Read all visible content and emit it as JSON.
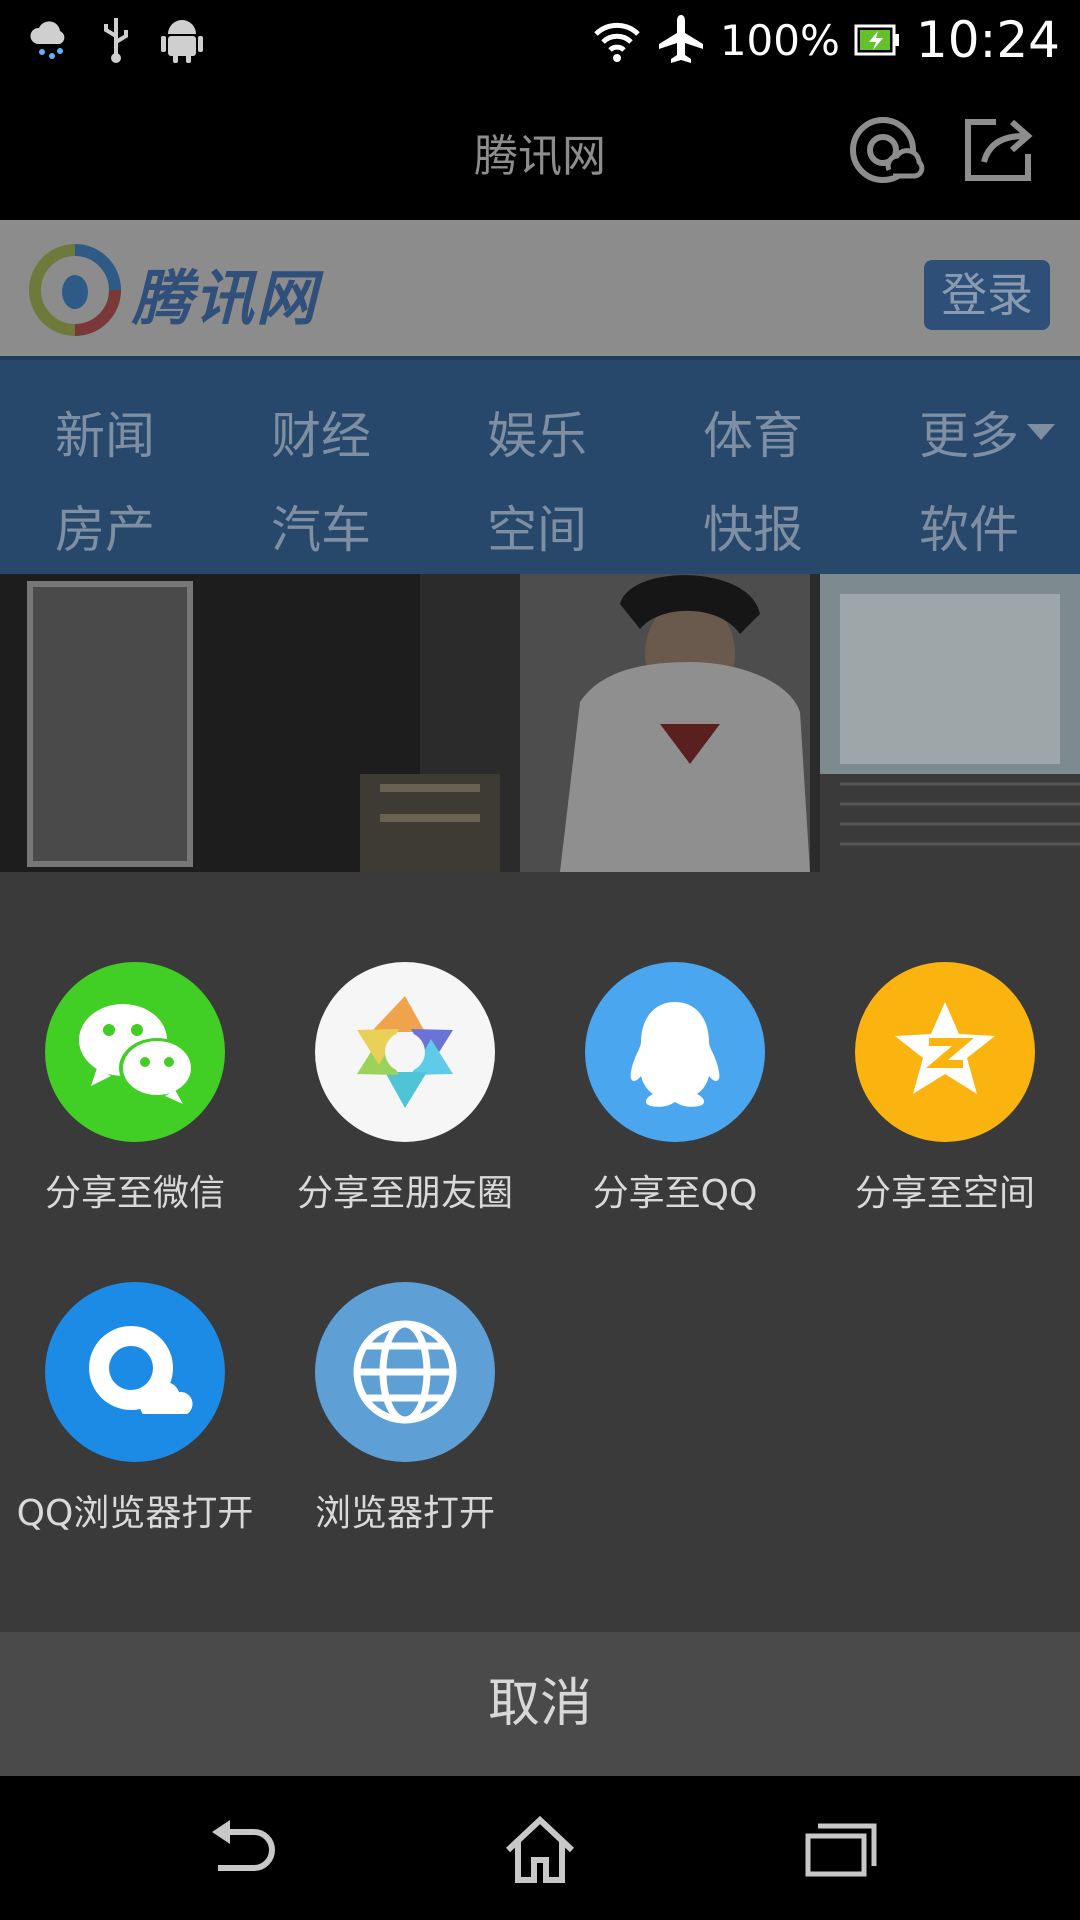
{
  "status_bar": {
    "left_icons": [
      "weather-rain-icon",
      "usb-icon",
      "android-debug-icon"
    ],
    "right_icons": [
      "wifi-icon",
      "airplane-icon",
      "battery-charging-icon"
    ],
    "battery": "100%",
    "time": "10:24"
  },
  "app_bar": {
    "title": "腾讯网",
    "icons": [
      "qq-browser-icon",
      "share-icon"
    ]
  },
  "page": {
    "logo_text": "腾讯网",
    "login_label": "登录",
    "nav_row1": [
      "新闻",
      "财经",
      "娱乐",
      "体育",
      "更多"
    ],
    "nav_row2": [
      "房产",
      "汽车",
      "空间",
      "快报",
      "软件"
    ]
  },
  "share_sheet": {
    "items": [
      {
        "label": "分享至微信",
        "icon": "wechat-icon",
        "color": "#41cf26"
      },
      {
        "label": "分享至朋友圈",
        "icon": "moments-icon",
        "color": "#f6f6f6"
      },
      {
        "label": "分享至QQ",
        "icon": "qq-icon",
        "color": "#4aa6ee"
      },
      {
        "label": "分享至空间",
        "icon": "qzone-icon",
        "color": "#fbb40f"
      },
      {
        "label": "QQ浏览器打开",
        "icon": "qq-browser-icon",
        "color": "#1b8be6"
      },
      {
        "label": "浏览器打开",
        "icon": "globe-icon",
        "color": "#5e9fd6"
      }
    ],
    "cancel_label": "取消"
  },
  "nav_bar": {
    "buttons": [
      "back-icon",
      "home-icon",
      "recents-icon"
    ]
  }
}
